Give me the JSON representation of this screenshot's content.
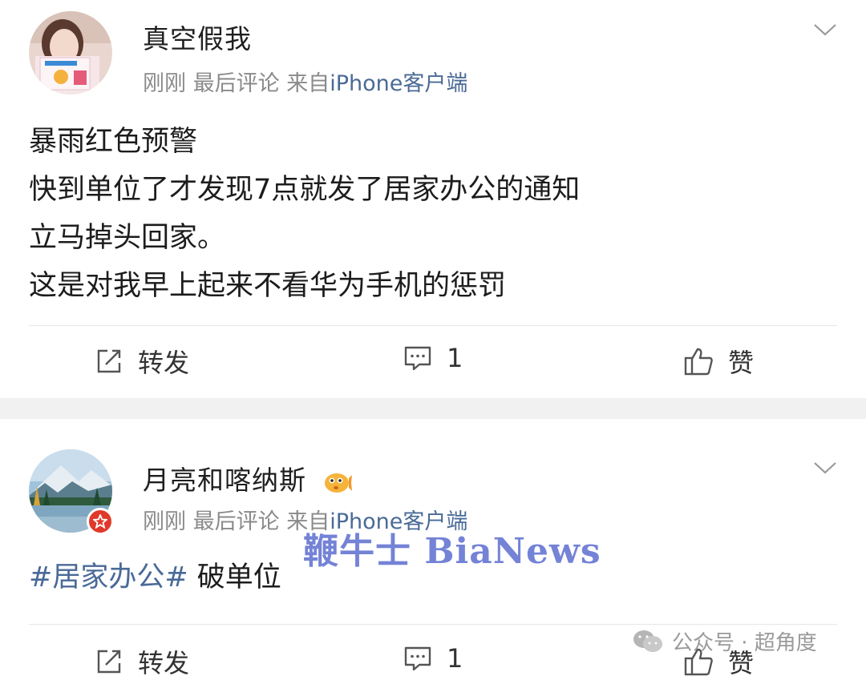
{
  "posts": [
    {
      "username": "真空假我",
      "time": "刚刚",
      "meta_label": "最后评论",
      "source_prefix": "来自",
      "source": "iPhone客户端",
      "content_lines": [
        "暴雨红色预警",
        "快到单位了才发现7点就发了居家办公的通知",
        "立马掉头回家。",
        "这是对我早上起来不看华为手机的惩罚"
      ],
      "actions": {
        "repost": "转发",
        "comments": "1",
        "like": "赞"
      }
    },
    {
      "username": "月亮和喀纳斯",
      "time": "刚刚",
      "meta_label": "最后评论",
      "source_prefix": "来自",
      "source": "iPhone客户端",
      "hashtag": "#居家办公#",
      "content": " 破单位",
      "actions": {
        "repost": "转发",
        "comments": "1",
        "like": "赞"
      }
    }
  ],
  "watermark": "鞭牛士 BiaNews",
  "wechat_mark": "公众号 · 超角度",
  "colors": {
    "link": "#4a6a97",
    "meta": "#8a8a8a",
    "separator": "#f1f1f1"
  }
}
